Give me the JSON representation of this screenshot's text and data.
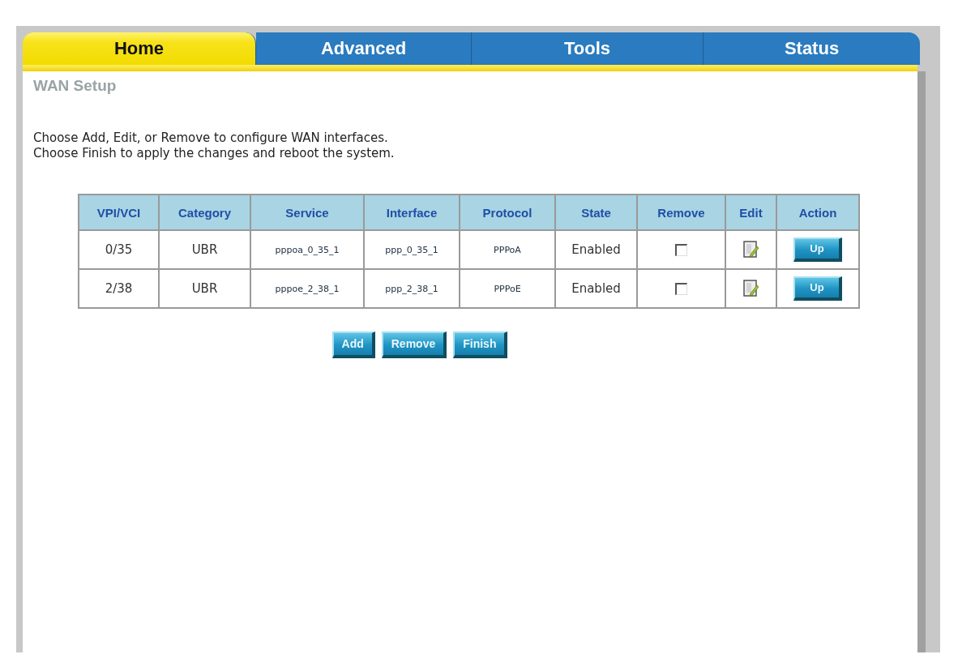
{
  "tabs": [
    {
      "label": "Home",
      "selected": true
    },
    {
      "label": "Advanced",
      "selected": false
    },
    {
      "label": "Tools",
      "selected": false
    },
    {
      "label": "Status",
      "selected": false
    }
  ],
  "page_title": "WAN Setup",
  "instructions": [
    "Choose Add, Edit, or Remove to configure WAN interfaces.",
    "Choose Finish to apply the changes and reboot the system."
  ],
  "table": {
    "columns": [
      "VPI/VCI",
      "Category",
      "Service",
      "Interface",
      "Protocol",
      "State",
      "Remove",
      "Edit",
      "Action"
    ],
    "rows": [
      {
        "vpi_vci": "0/35",
        "category": "UBR",
        "service": "pppoa_0_35_1",
        "interface": "ppp_0_35_1",
        "protocol": "PPPoA",
        "state": "Enabled",
        "remove_checked": false,
        "action": "Up"
      },
      {
        "vpi_vci": "2/38",
        "category": "UBR",
        "service": "pppoe_2_38_1",
        "interface": "ppp_2_38_1",
        "protocol": "PPPoE",
        "state": "Enabled",
        "remove_checked": false,
        "action": "Up"
      }
    ]
  },
  "buttons": [
    "Add",
    "Remove",
    "Finish"
  ]
}
